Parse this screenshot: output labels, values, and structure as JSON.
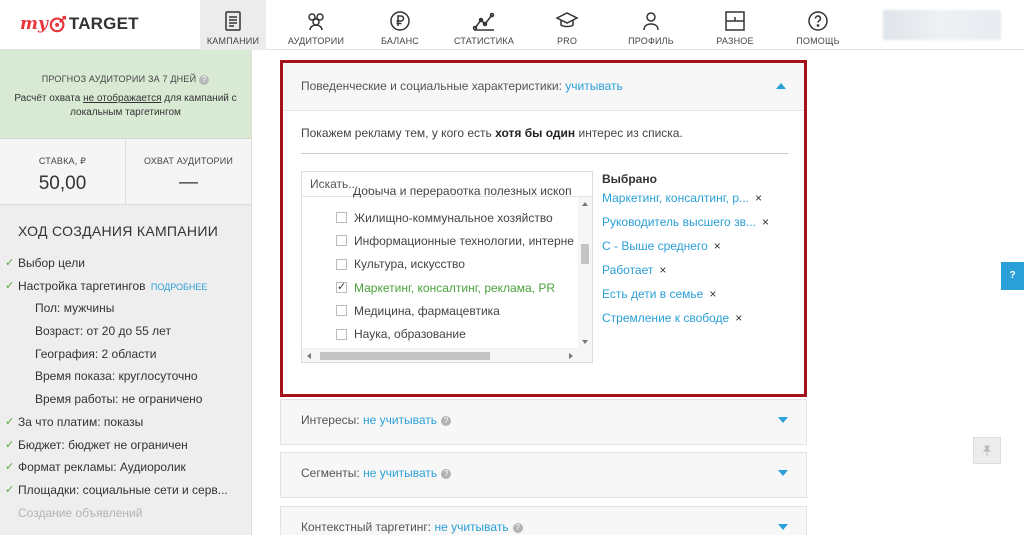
{
  "brand": {
    "my": "my",
    "target": "TARGET",
    "accent_color": "#e8363c"
  },
  "nav": [
    {
      "label": "КАМПАНИИ",
      "icon": "document-icon",
      "active": true
    },
    {
      "label": "АУДИТОРИИ",
      "icon": "audience-icon"
    },
    {
      "label": "БАЛАНС",
      "icon": "ruble-icon"
    },
    {
      "label": "СТАТИСТИКА",
      "icon": "chart-line-icon"
    },
    {
      "label": "PRO",
      "icon": "graduation-cap-icon"
    },
    {
      "label": "ПРОФИЛЬ",
      "icon": "user-icon"
    },
    {
      "label": "РАЗНОЕ",
      "icon": "grid-box-icon"
    },
    {
      "label": "ПОМОЩЬ",
      "icon": "question-icon"
    }
  ],
  "sidebar": {
    "forecast_title": "ПРОГНОЗ АУДИТОРИИ ЗА 7 ДНЕЙ",
    "forecast_note_1": "Расчёт охвата ",
    "forecast_note_link": "не отображается",
    "forecast_note_2": " для кампаний с локальным таргетингом",
    "bid_label": "СТАВКА, ₽",
    "bid_value": "50,00",
    "reach_label": "ОХВАТ АУДИТОРИИ",
    "reach_value": "—",
    "progress_title": "ХОД СОЗДАНИЯ КАМПАНИИ",
    "steps": [
      {
        "type": "done",
        "label": "Выбор цели"
      },
      {
        "type": "done",
        "label": "Настройка таргетингов",
        "link": "ПОДРОБНЕЕ"
      },
      {
        "type": "sub",
        "label": "Пол: мужчины"
      },
      {
        "type": "sub",
        "label": "Возраст: от 20 до 55 лет"
      },
      {
        "type": "sub",
        "label": "География: 2 области"
      },
      {
        "type": "sub",
        "label": "Время показа: круглосуточно"
      },
      {
        "type": "sub",
        "label": "Время работы: не ограничено"
      },
      {
        "type": "done",
        "label": "За что платим: показы"
      },
      {
        "type": "done",
        "label": "Бюджет: бюджет не ограничен"
      },
      {
        "type": "done",
        "label": "Формат рекламы: Аудиоролик"
      },
      {
        "type": "done",
        "label": "Площадки: социальные сети и серв..."
      },
      {
        "type": "muted",
        "label": "Создание объявлений"
      }
    ]
  },
  "panel": {
    "header_label": "Поведенческие и социальные характеристики: ",
    "header_value": "учитывать",
    "intro_1": "Покажем рекламу тем, у кого есть ",
    "intro_bold": "хотя бы один",
    "intro_2": " интерес из списка.",
    "search_placeholder": "Искать...",
    "cut_item": "Добыча и переработка полезных ископ",
    "options": [
      {
        "label": "Жилищно-коммунальное хозяйство",
        "selected": false
      },
      {
        "label": "Информационные технологии, интерне",
        "selected": false
      },
      {
        "label": "Культура, искусство",
        "selected": false
      },
      {
        "label": "Маркетинг, консалтинг, реклама, PR",
        "selected": true
      },
      {
        "label": "Медицина, фармацевтика",
        "selected": false
      },
      {
        "label": "Наука, образование",
        "selected": false
      }
    ],
    "chosen_title": "Выбрано",
    "chosen": [
      "Маркетинг, консалтинг, р...",
      "Руководитель высшего зв...",
      "С - Выше среднего",
      "Работает",
      "Есть дети в семье",
      "Стремление к свободе"
    ],
    "remove_glyph": "×"
  },
  "sections": [
    {
      "label": "Интересы: ",
      "value": "не учитывать"
    },
    {
      "label": "Сегменты: ",
      "value": "не учитывать"
    },
    {
      "label": "Контекстный таргетинг: ",
      "value": "не учитывать"
    }
  ],
  "help_tab": "?",
  "colors": {
    "link": "#2b9fd8",
    "selected": "#4aa33b",
    "highlight_border": "#a3111b",
    "forecast_bg": "#d9ead4"
  }
}
